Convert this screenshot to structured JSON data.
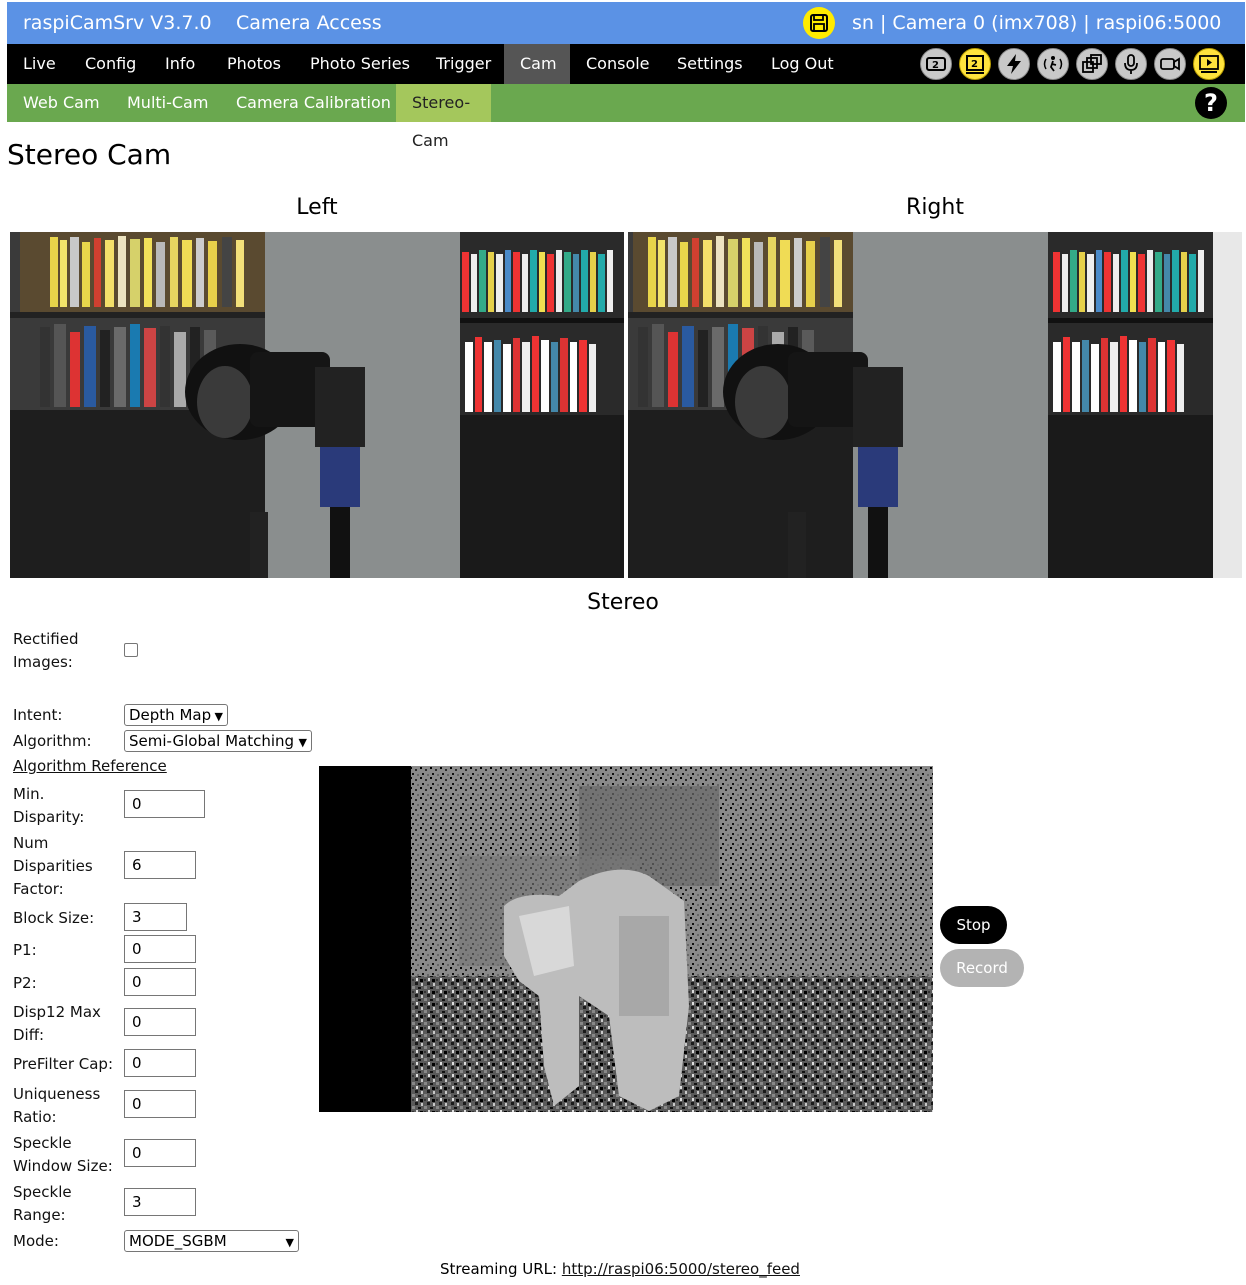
{
  "header": {
    "app_title": "raspiCamSrv V3.7.0",
    "section_title": "Camera Access",
    "status": "sn | Camera 0 (imx708) | raspi06:5000",
    "save_icon": "floppy-disk-icon"
  },
  "main_nav": {
    "items": [
      "Live",
      "Config",
      "Info",
      "Photos",
      "Photo Series",
      "Trigger",
      "Cam",
      "Console",
      "Settings",
      "Log Out"
    ],
    "active": "Cam"
  },
  "status_icons": [
    "camera-2-icon",
    "camera-2-selected-icon",
    "flash-icon",
    "motion-icon",
    "multi-window-icon",
    "microphone-icon",
    "video-camera-icon",
    "streaming-display-icon"
  ],
  "sub_nav": {
    "items": [
      "Web Cam",
      "Multi-Cam",
      "Camera Calibration",
      "Stereo-Cam"
    ],
    "active": "Stereo-Cam",
    "help_label": "?"
  },
  "page": {
    "title": "Stereo Cam",
    "left_label": "Left",
    "right_label": "Right",
    "stereo_label": "Stereo"
  },
  "form": {
    "rectified_label": "Rectified Images:",
    "rectified_checked": false,
    "intent_label": "Intent:",
    "intent_value": "Depth Map",
    "algorithm_label": "Algorithm:",
    "algorithm_value": "Semi-Global Matching",
    "algorithm_reference": "Algorithm Reference",
    "min_disparity_label": "Min. Disparity:",
    "min_disparity": "0",
    "num_disparities_label": "Num Disparities Factor:",
    "num_disparities": "6",
    "block_size_label": "Block Size:",
    "block_size": "3",
    "p1_label": "P1:",
    "p1": "0",
    "p2_label": "P2:",
    "p2": "0",
    "disp12_label": "Disp12 Max Diff:",
    "disp12": "0",
    "prefilter_label": "PreFilter Cap:",
    "prefilter": "0",
    "uniqueness_label": "Uniqueness Ratio:",
    "uniqueness": "0",
    "speckle_window_label": "Speckle Window Size:",
    "speckle_window": "0",
    "speckle_range_label": "Speckle Range:",
    "speckle_range": "3",
    "mode_label": "Mode:",
    "mode_value": "MODE_SGBM"
  },
  "controls": {
    "stop_label": "Stop",
    "record_label": "Record"
  },
  "streaming": {
    "label": "Streaming URL:",
    "url": "http://raspi06:5000/stereo_feed"
  },
  "colors": {
    "title_bar": "#5b92e5",
    "main_nav": "#000000",
    "main_nav_active": "#555555",
    "sub_nav": "#6aa84f",
    "sub_nav_active": "#a4c75c",
    "highlight_icon": "#ffe33d"
  }
}
